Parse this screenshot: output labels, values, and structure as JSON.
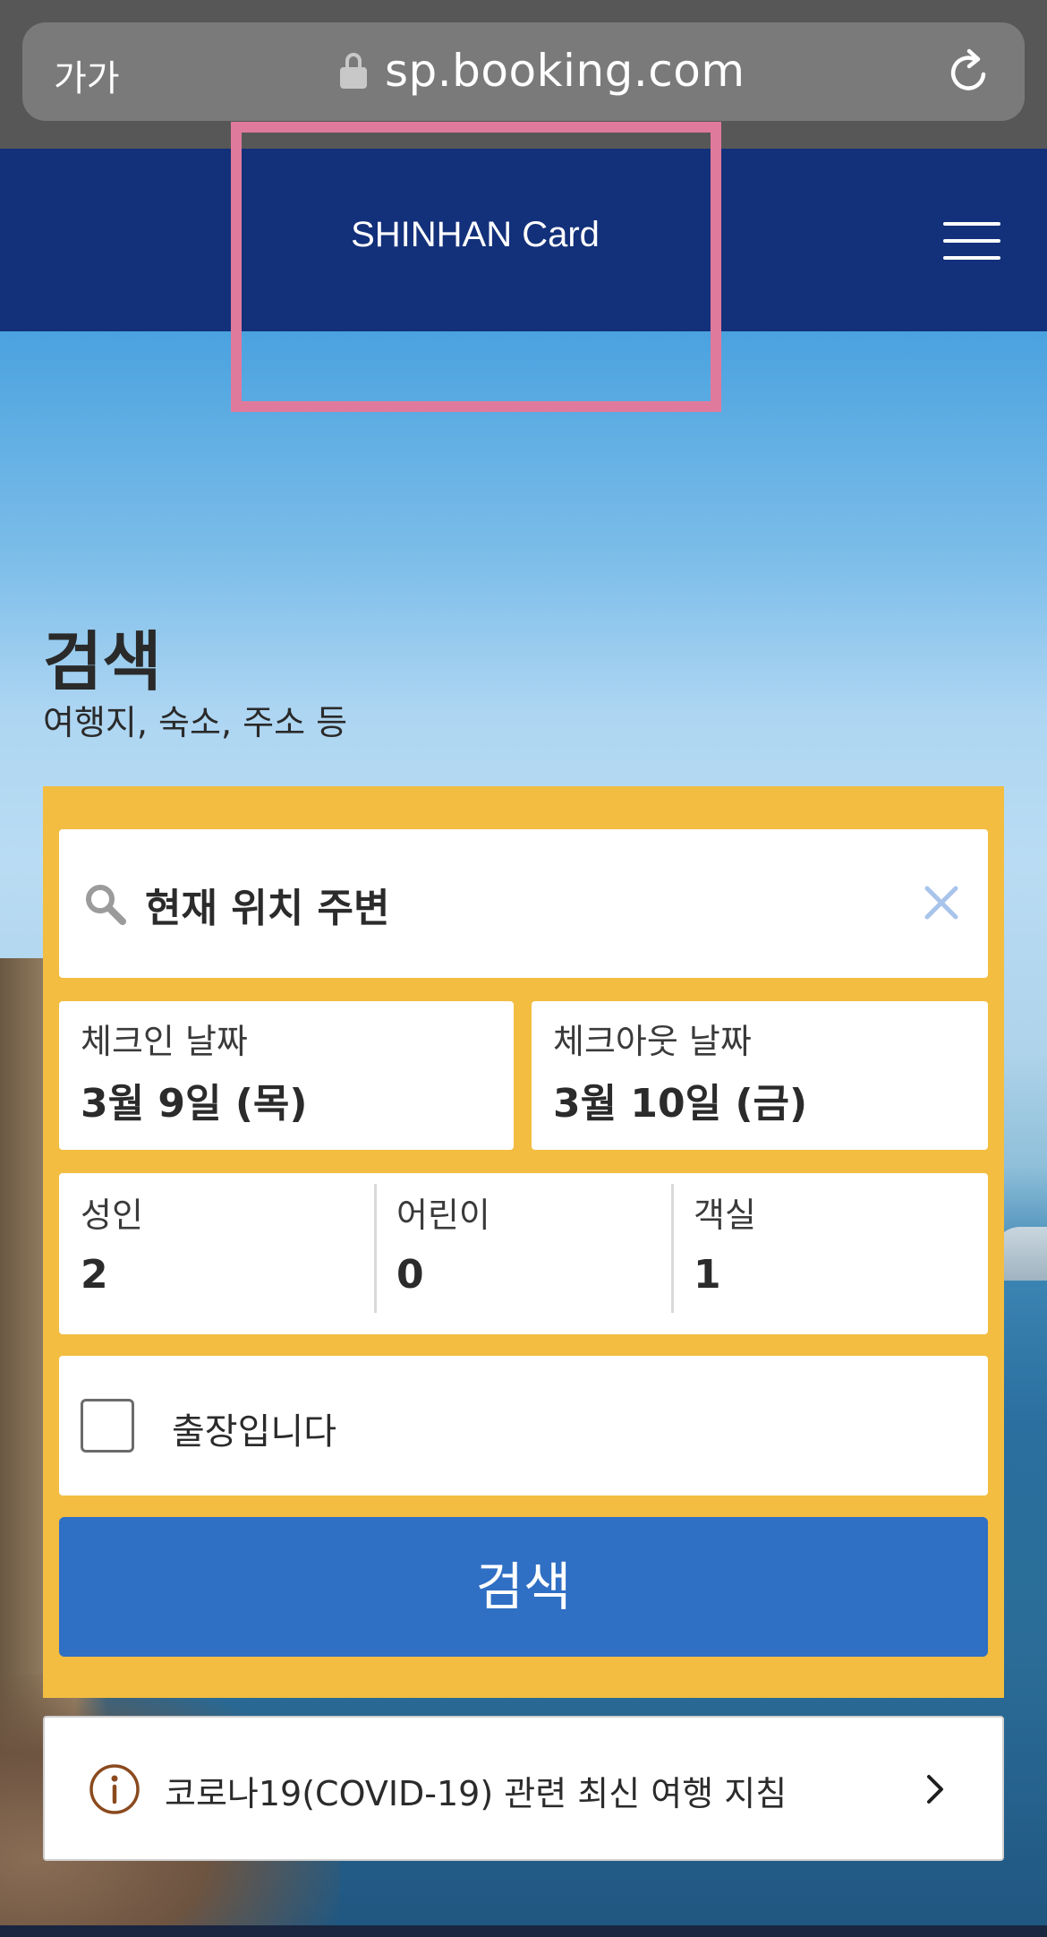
{
  "browser": {
    "text_size_label": "가가",
    "url": "sp.booking.com"
  },
  "header": {
    "brand": "SHINHAN Card"
  },
  "search": {
    "heading": "검색",
    "subheading": "여행지, 숙소, 주소 등",
    "destination_value": "현재 위치 주변",
    "checkin": {
      "label": "체크인 날짜",
      "value": "3월 9일 (목)"
    },
    "checkout": {
      "label": "체크아웃 날짜",
      "value": "3월 10일 (금)"
    },
    "guests": {
      "adults": {
        "label": "성인",
        "value": "2"
      },
      "children": {
        "label": "어린이",
        "value": "0"
      },
      "rooms": {
        "label": "객실",
        "value": "1"
      }
    },
    "business_trip_label": "출장입니다",
    "search_button_label": "검색"
  },
  "notice": {
    "text": "코로나19(COVID-19) 관련 최신 여행 지침"
  },
  "colors": {
    "nav_bg": "#13307a",
    "panel_yellow": "#f2bd41",
    "button_blue": "#2f6fc4",
    "highlight_pink": "#e07a9c",
    "info_brown": "#8a4a1e"
  },
  "icons": [
    "lock-icon",
    "reload-icon",
    "menu-icon",
    "search-icon",
    "clear-icon",
    "info-icon",
    "chevron-right-icon"
  ]
}
